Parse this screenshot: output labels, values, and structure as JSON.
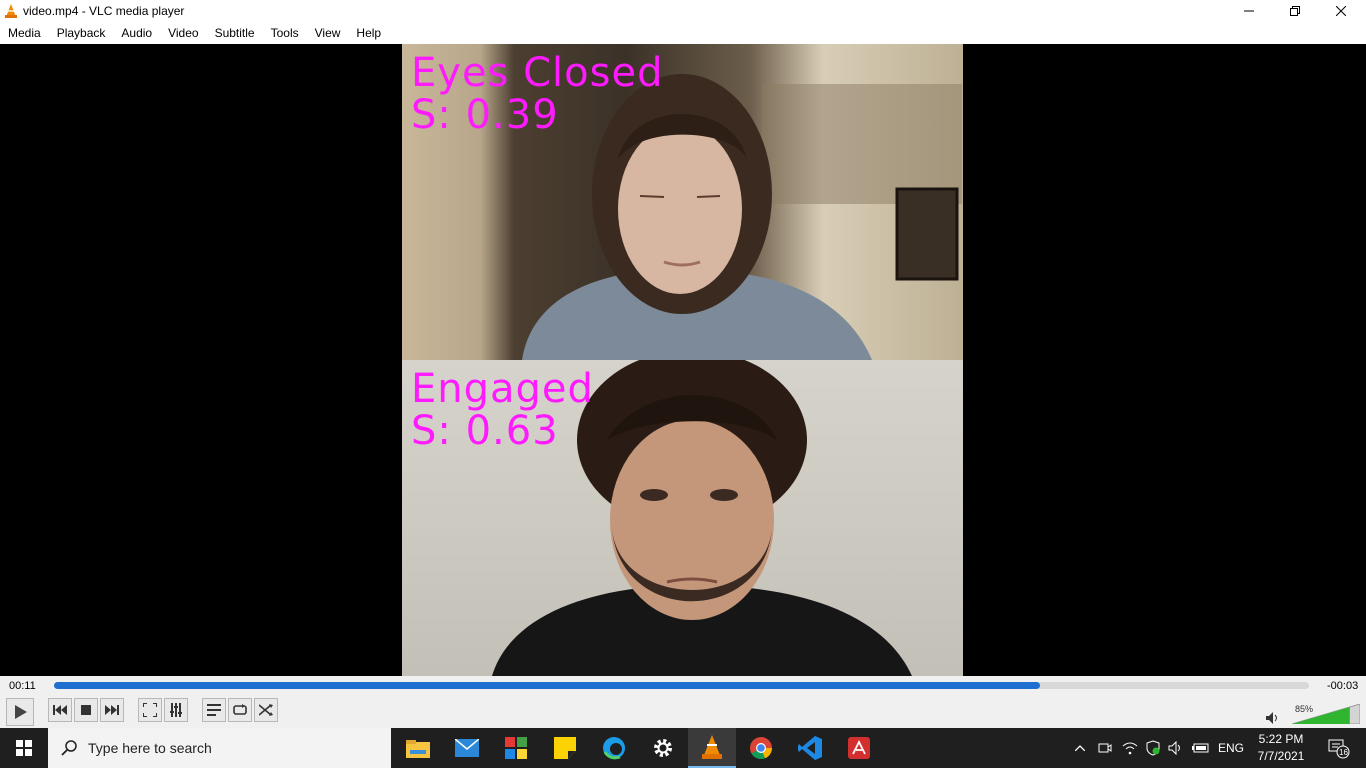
{
  "window": {
    "title": "video.mp4 - VLC media player"
  },
  "menu": [
    "Media",
    "Playback",
    "Audio",
    "Video",
    "Subtitle",
    "Tools",
    "View",
    "Help"
  ],
  "video": {
    "top": {
      "label": "Eyes Closed",
      "score": "S: 0.39"
    },
    "bottom": {
      "label": "Engaged",
      "score": "S: 0.63"
    },
    "overlay_color": "#ff1aff"
  },
  "playback": {
    "elapsed": "00:11",
    "remaining": "-00:03",
    "progress": 0.786,
    "volume_label": "85%",
    "volume": 0.85
  },
  "taskbar": {
    "search_placeholder": "Type here to search",
    "language": "ENG",
    "time": "5:22 PM",
    "date": "7/7/2021",
    "notifications": "16"
  },
  "colors": {
    "accent": "#1e6fd0",
    "taskbar": "#1f1f1f"
  }
}
